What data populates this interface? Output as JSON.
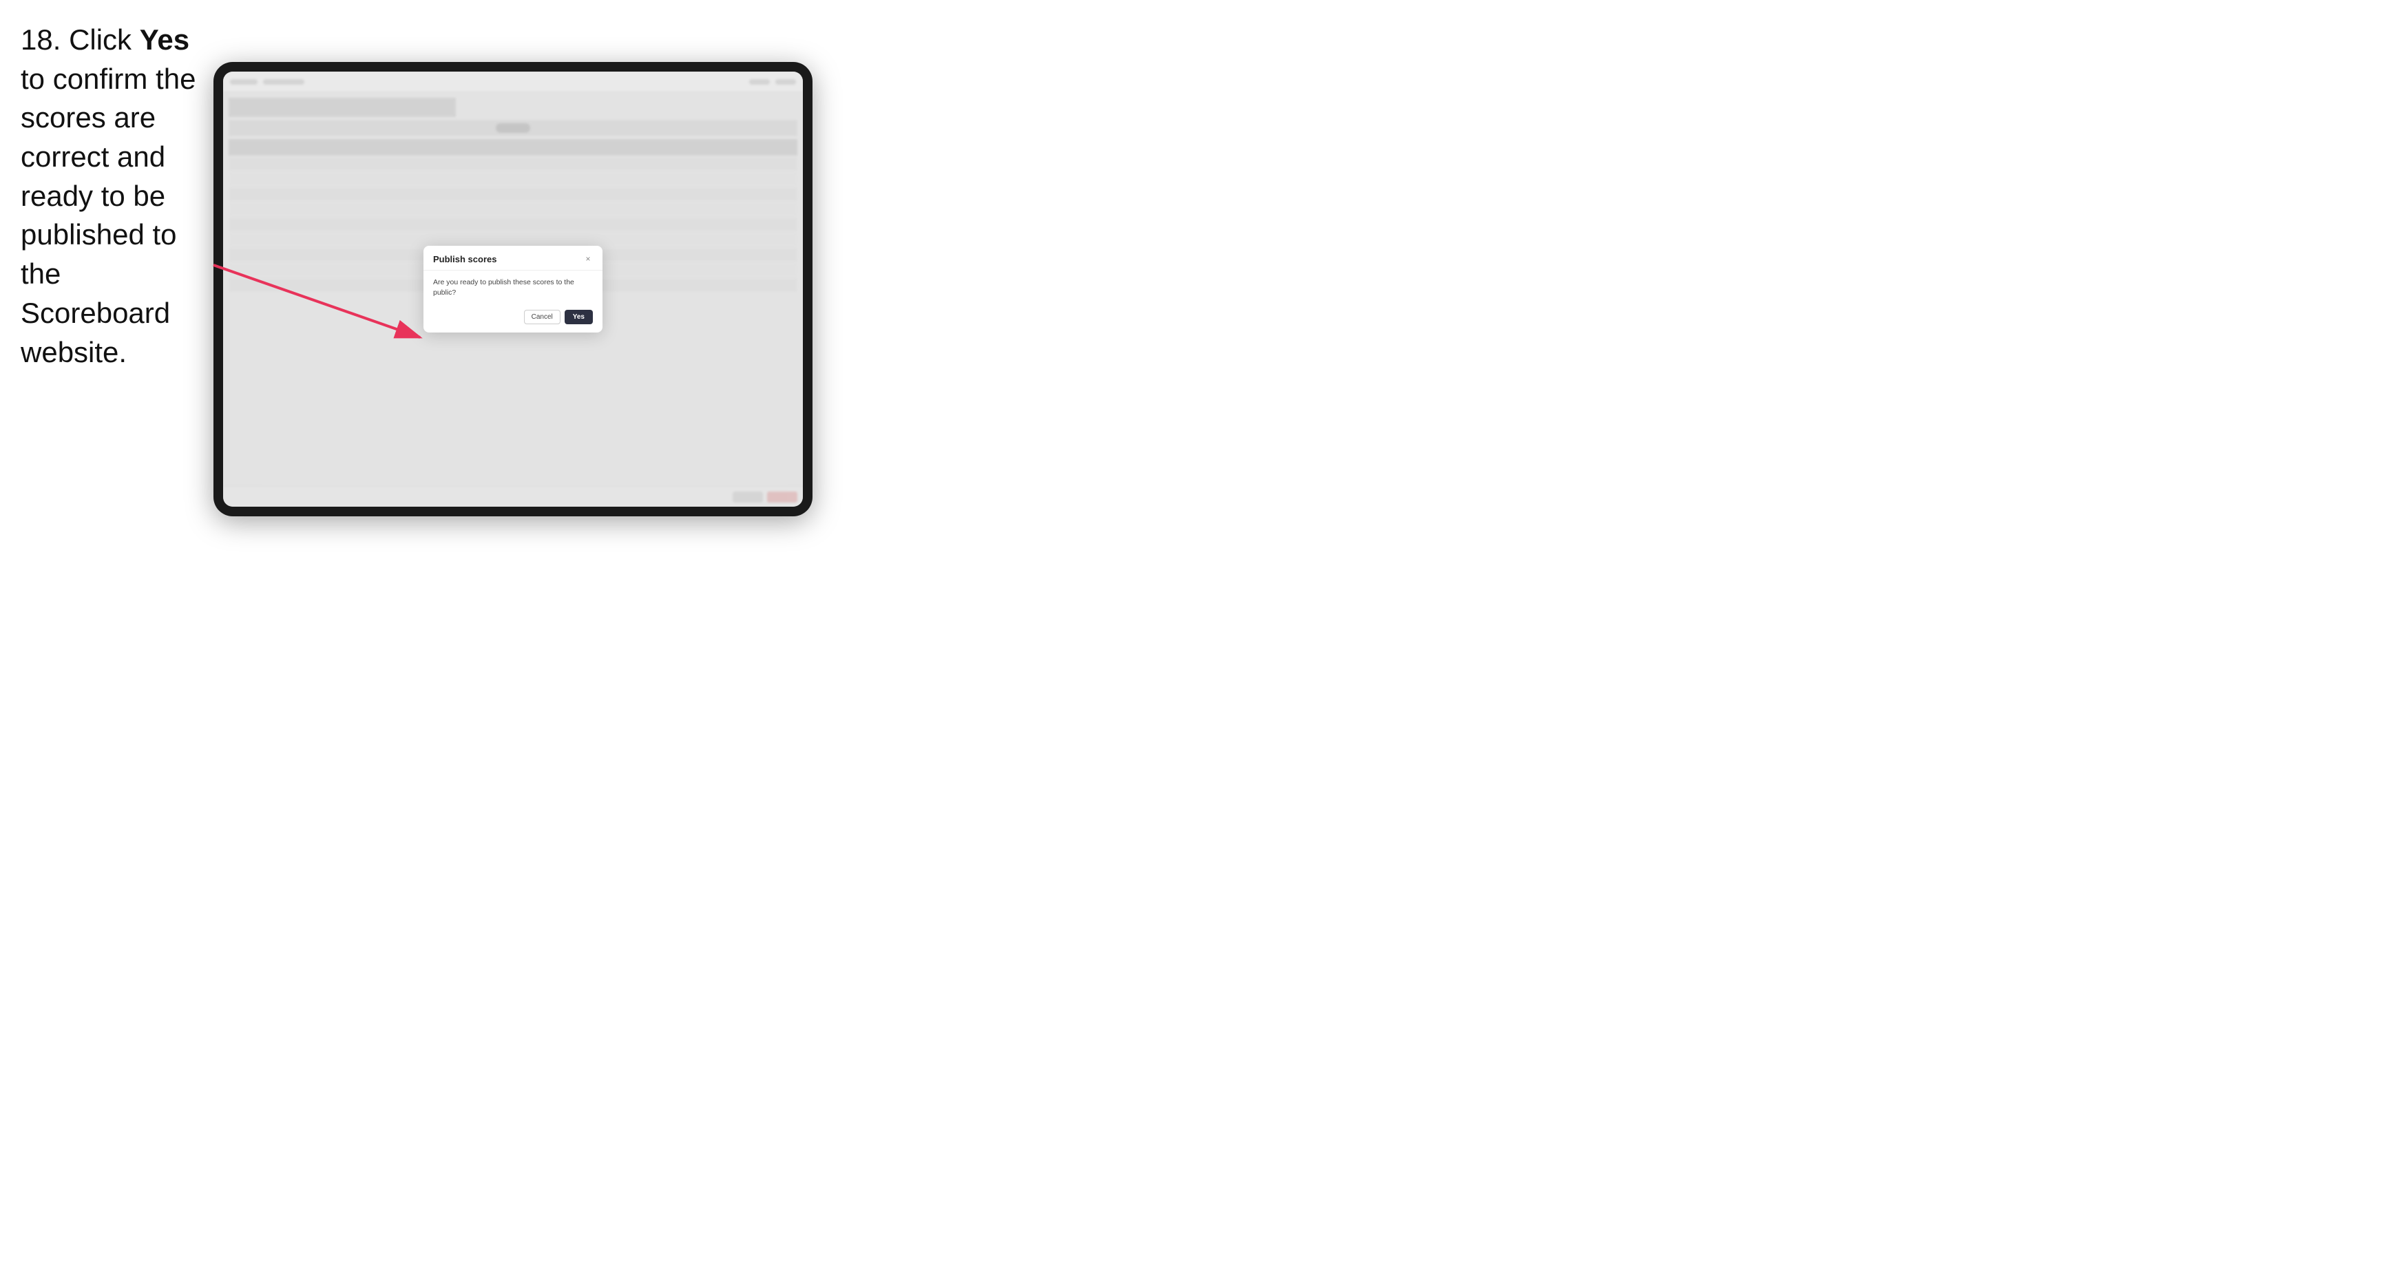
{
  "instruction": {
    "step_number": "18.",
    "text_before_bold": "Click ",
    "bold_word": "Yes",
    "text_after_bold": " to confirm the scores are correct and ready to be published to the Scoreboard website."
  },
  "tablet": {
    "modal": {
      "title": "Publish scores",
      "message": "Are you ready to publish these scores to the public?",
      "cancel_label": "Cancel",
      "yes_label": "Yes",
      "close_icon": "×"
    }
  },
  "arrow": {
    "color": "#e8335a"
  }
}
